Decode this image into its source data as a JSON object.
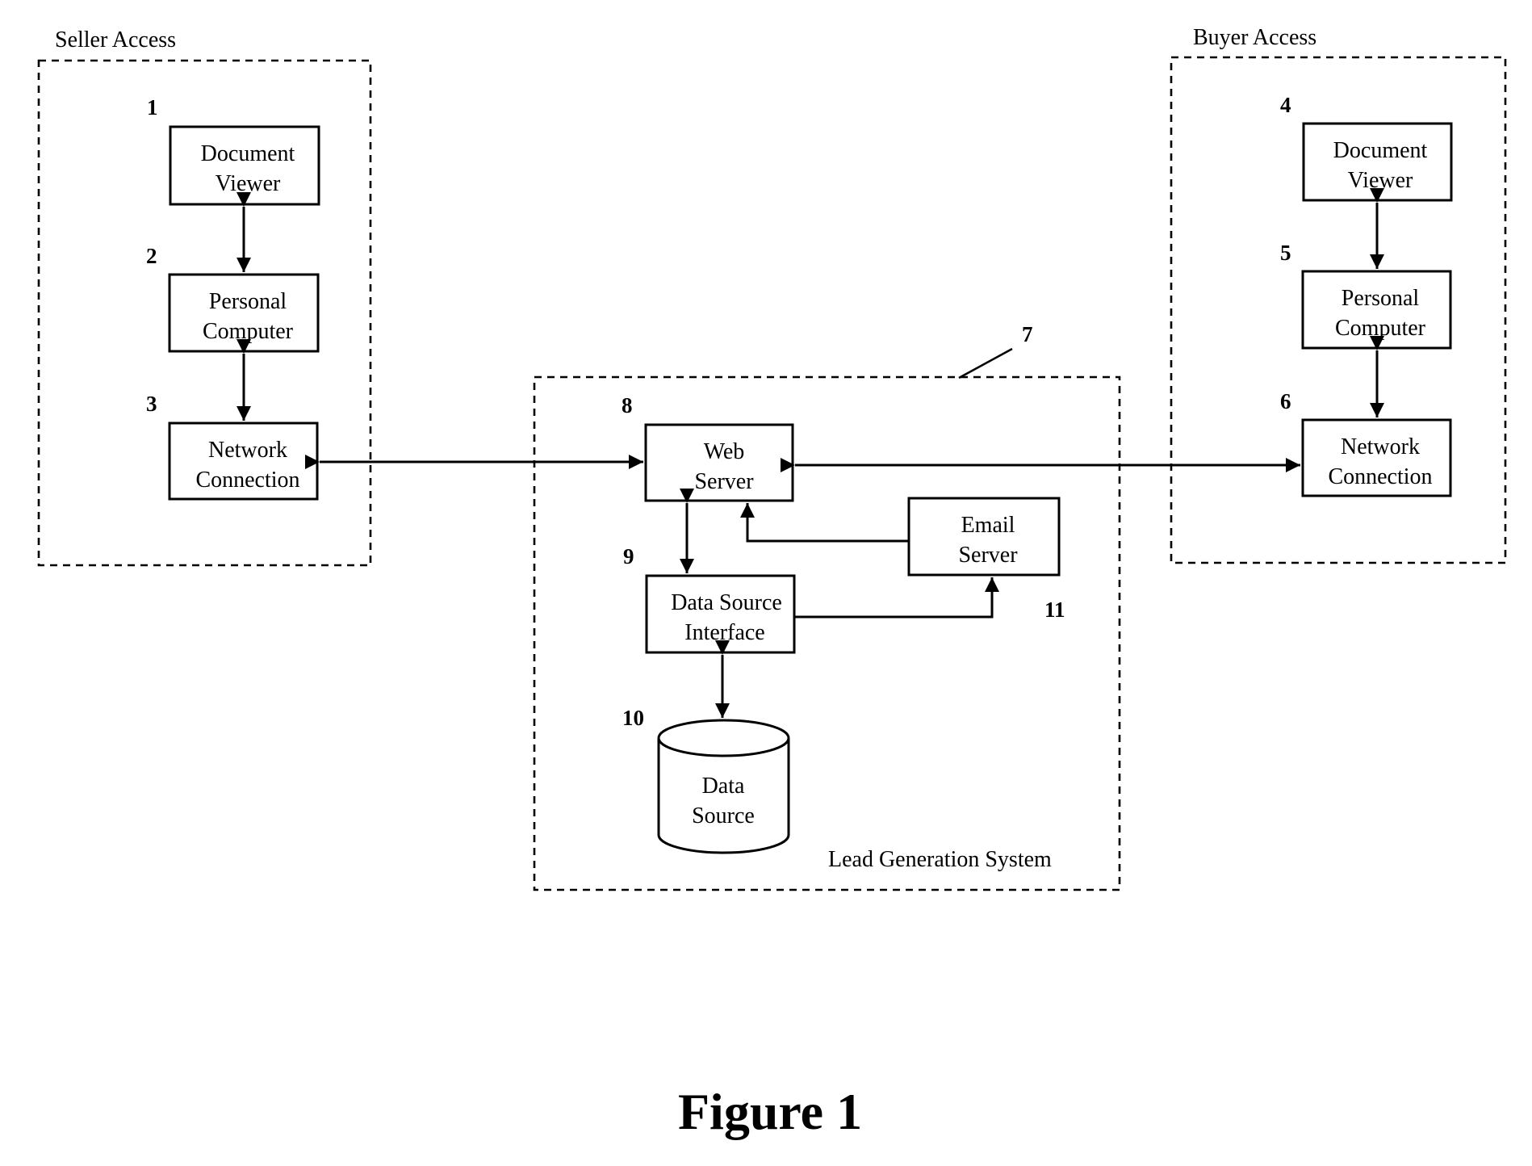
{
  "figure": {
    "caption": "Figure 1"
  },
  "groups": {
    "seller": {
      "label": "Seller Access"
    },
    "buyer": {
      "label": "Buyer Access"
    },
    "lead_generation": {
      "label": "Lead Generation System",
      "ref": "7"
    }
  },
  "nodes": {
    "seller_document_viewer": {
      "ref": "1",
      "line1": "Document",
      "line2": "Viewer"
    },
    "seller_personal_computer": {
      "ref": "2",
      "line1": "Personal",
      "line2": "Computer"
    },
    "seller_network_connection": {
      "ref": "3",
      "line1": "Network",
      "line2": "Connection"
    },
    "buyer_document_viewer": {
      "ref": "4",
      "line1": "Document",
      "line2": "Viewer"
    },
    "buyer_personal_computer": {
      "ref": "5",
      "line1": "Personal",
      "line2": "Computer"
    },
    "buyer_network_connection": {
      "ref": "6",
      "line1": "Network",
      "line2": "Connection"
    },
    "web_server": {
      "ref": "8",
      "line1": "Web",
      "line2": "Server"
    },
    "data_source_interface": {
      "ref": "9",
      "line1": "Data Source",
      "line2": "Interface"
    },
    "data_source": {
      "ref": "10",
      "line1": "Data",
      "line2": "Source"
    },
    "email_server": {
      "ref": "11",
      "line1": "Email",
      "line2": "Server"
    }
  },
  "edges": [
    {
      "from": "seller_document_viewer",
      "to": "seller_personal_computer",
      "direction": "bidirectional"
    },
    {
      "from": "seller_personal_computer",
      "to": "seller_network_connection",
      "direction": "bidirectional"
    },
    {
      "from": "seller_network_connection",
      "to": "web_server",
      "direction": "bidirectional"
    },
    {
      "from": "buyer_document_viewer",
      "to": "buyer_personal_computer",
      "direction": "bidirectional"
    },
    {
      "from": "buyer_personal_computer",
      "to": "buyer_network_connection",
      "direction": "bidirectional"
    },
    {
      "from": "web_server",
      "to": "buyer_network_connection",
      "direction": "bidirectional"
    },
    {
      "from": "web_server",
      "to": "data_source_interface",
      "direction": "bidirectional"
    },
    {
      "from": "data_source_interface",
      "to": "data_source",
      "direction": "bidirectional"
    },
    {
      "from": "data_source_interface",
      "to": "email_server",
      "direction": "forward"
    },
    {
      "from": "email_server",
      "to": "web_server",
      "direction": "forward"
    }
  ]
}
